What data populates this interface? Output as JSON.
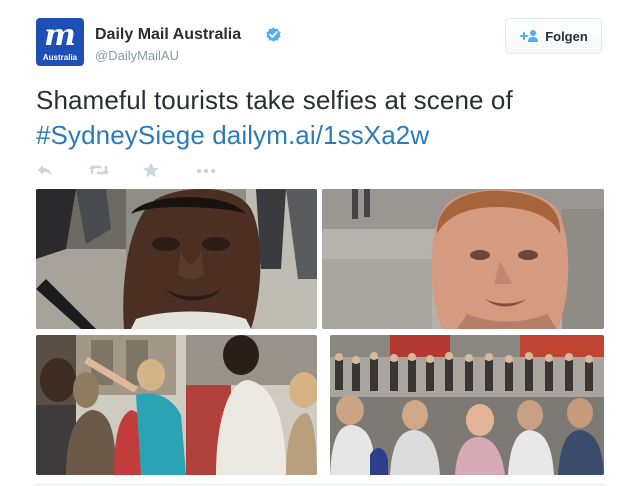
{
  "account": {
    "name": "Daily Mail Australia",
    "handle": "@DailyMailAU",
    "avatar_glyph": "m",
    "avatar_sub": "Australia",
    "verified": true,
    "avatar_color": "#1d4fb6",
    "verified_color": "#55acee"
  },
  "follow_button": {
    "label": "Folgen",
    "icon": "add-user-icon"
  },
  "tweet": {
    "text_plain": "Shameful tourists take selfies at scene of",
    "hashtag": "#SydneySiege",
    "link": "dailym.ai/1ssXa2w",
    "link_color": "#2b7bb9"
  },
  "actions": [
    {
      "name": "reply",
      "icon": "reply-icon"
    },
    {
      "name": "retweet",
      "icon": "retweet-icon"
    },
    {
      "name": "favorite",
      "icon": "star-icon"
    },
    {
      "name": "more",
      "icon": "more-dots-icon"
    }
  ],
  "photos": [
    {
      "subject": "man-selfie-close-up"
    },
    {
      "subject": "red-haired-man-selfie"
    },
    {
      "subject": "women-taking-photos"
    },
    {
      "subject": "crowd-taking-photos"
    }
  ]
}
